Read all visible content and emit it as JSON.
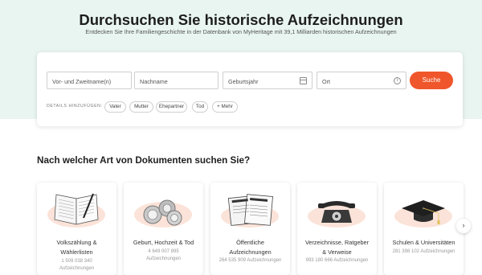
{
  "hero": {
    "title": "Durchsuchen Sie historische Aufzeichnungen",
    "subtitle": "Entdecken Sie Ihre Familiengeschichte in der Datenbank von MyHeritage mit 39,1 Milliarden historischen Aufzeichnungen"
  },
  "search": {
    "first_name_placeholder": "Vor- und Zweitname(n)",
    "last_name_placeholder": "Nachname",
    "birth_year_placeholder": "Geburtsjahr",
    "place_placeholder": "Ort",
    "button_label": "Suche",
    "details_label": "DETAILS HINZUFÜGEN:",
    "chips": [
      "Vater",
      "Mutter",
      "Ehepartner",
      "Tod",
      "+ Mehr"
    ],
    "info_glyph": "i"
  },
  "categories": {
    "heading": "Nach welcher Art von Dokumenten suchen Sie?",
    "items": [
      {
        "title_line1": "Volkszählung &",
        "title_line2": "Wählerlisten",
        "count": "1 509 038 340",
        "count_suffix": "Aufzeichnungen",
        "icon": "census-book-icon"
      },
      {
        "title_line1": "Geburt, Hochzeit & Tod",
        "count": "4 649 007 895",
        "count_suffix": "Aufzeichnungen",
        "icon": "wedding-rings-icon"
      },
      {
        "title_line1": "Öffentliche",
        "title_line2": "Aufzeichnungen",
        "count_line": "264 535 909 Aufzeichnungen",
        "icon": "newspaper-icon"
      },
      {
        "title_line1": "Verzeichnisse, Ratgeber",
        "title_line2": "& Verweise",
        "count_line": "993 180 666 Aufzeichnungen",
        "icon": "telephone-icon"
      },
      {
        "title_line1": "Schulen & Universitäten",
        "count_line": "281 398 102 Aufzeichnungen",
        "icon": "graduation-cap-icon"
      }
    ],
    "next_glyph": "›"
  },
  "colors": {
    "accent": "#f0562b",
    "hero_bg": "#e9f5f1",
    "blob": "#fbe3d9"
  }
}
